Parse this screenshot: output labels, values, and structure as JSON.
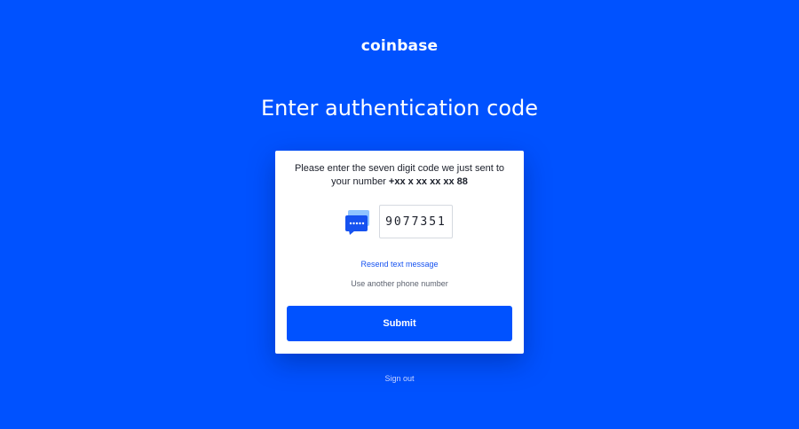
{
  "brand": {
    "logo_text": "coinbase",
    "primary_color": "#0052ff",
    "link_color": "#1652f0"
  },
  "page": {
    "title": "Enter authentication code"
  },
  "card": {
    "instructions_line1": "Please enter the seven digit code we just sent to",
    "instructions_prefix": "your number ",
    "masked_phone": "+xx x xx xx xx 88",
    "message_icon": "sms-chat-bubble-icon",
    "code_value": "9077351",
    "resend_label": "Resend text message",
    "another_phone_label": "Use another phone number",
    "submit_label": "Submit"
  },
  "footer": {
    "sign_out_label": "Sign out"
  }
}
